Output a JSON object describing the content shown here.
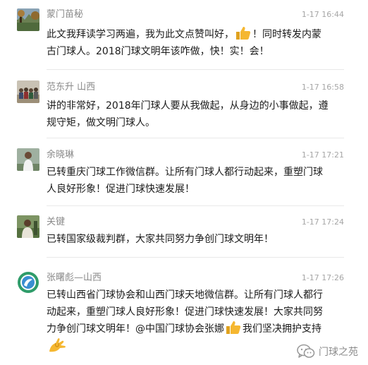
{
  "comments": [
    {
      "name": "蒙门苗秘",
      "time": "1-17 16:44",
      "lines": [
        "此文我拜读学习两遍，我为此文点赞叫好，",
        "！同时转发内蒙",
        "古门球人。2018门球文明年该咋做，快！实！会！"
      ],
      "avatar_icon": "landscape-avatar-icon"
    },
    {
      "name": "范东升   山西",
      "time": "1-17 16:58",
      "lines": [
        "讲的非常好，2018年门球人要从我做起，从身边的小事做起，遵",
        "规守矩，做文明门球人。"
      ],
      "avatar_icon": "group-photo-avatar-icon"
    },
    {
      "name": "余晓琳",
      "time": "1-17 17:21",
      "lines": [
        "已转重庆门球工作微信群。让所有门球人都行动起来，重塑门球",
        "人良好形象！促进门球快速发展！"
      ],
      "avatar_icon": "person-avatar-icon"
    },
    {
      "name": "关键",
      "time": "1-17 17:24",
      "lines": [
        "已转国家级裁判群，大家共同努力争创门球文明年！"
      ],
      "avatar_icon": "person-outdoor-avatar-icon"
    },
    {
      "name": "张曙彪—山西",
      "time": "1-17 17:26",
      "lines": [
        "已转山西省门球协会和山西门球天地微信群。让所有门球人都行",
        "动起来，重塑门球人良好形象！促进门球快速发展！大家共同努",
        "力争创门球文明年！@中国门球协会张娜",
        "我们坚决拥护支持"
      ],
      "avatar_icon": "logo-avatar-icon"
    }
  ],
  "watermark": {
    "text": "门球之苑",
    "icon": "wechat-icon"
  },
  "colors": {
    "name": "#8a8a8a",
    "time": "#a6a6a6",
    "text": "#1a1a1a",
    "thumb": "#f5b731"
  }
}
